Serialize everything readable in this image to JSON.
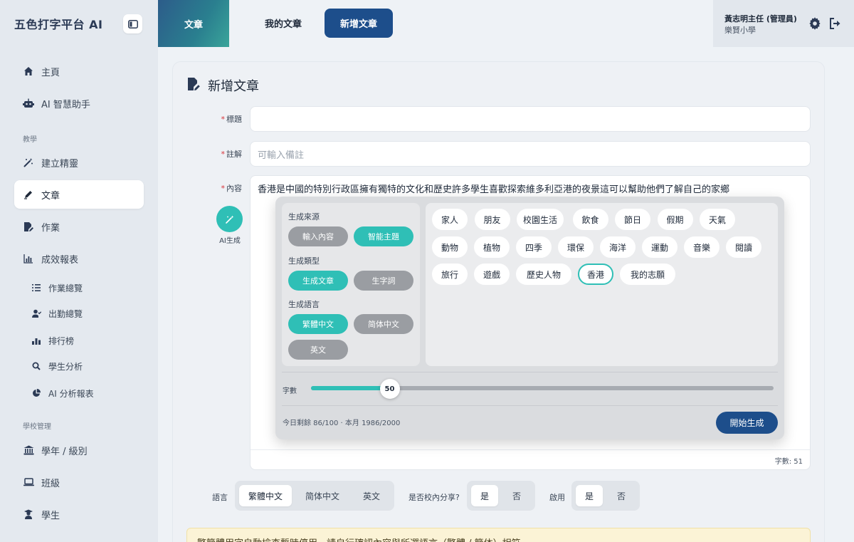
{
  "app": {
    "title": "五色打字平台 AI"
  },
  "sidebar": {
    "top_items": [
      {
        "label": "主頁",
        "icon": "home-icon"
      },
      {
        "label": "AI 智慧助手",
        "icon": "robot-icon"
      }
    ],
    "section_teaching": "教學",
    "teaching_items": [
      {
        "label": "建立精靈",
        "icon": "magic-wand-icon"
      },
      {
        "label": "文章",
        "icon": "pen-icon",
        "active": true
      },
      {
        "label": "作業",
        "icon": "file-edit-icon"
      },
      {
        "label": "成效報表",
        "icon": "bar-chart-icon"
      }
    ],
    "report_sub": [
      {
        "label": "作業總覽",
        "icon": "list-icon"
      },
      {
        "label": "出勤總覽",
        "icon": "user-check-icon"
      },
      {
        "label": "排行榜",
        "icon": "ranking-icon"
      },
      {
        "label": "學生分析",
        "icon": "search-icon"
      },
      {
        "label": "AI 分析報表",
        "icon": "pie-chart-icon"
      }
    ],
    "section_school": "學校管理",
    "school_items": [
      {
        "label": "學年 / 級別",
        "icon": "building-icon"
      },
      {
        "label": "班級",
        "icon": "laptop-icon"
      },
      {
        "label": "學生",
        "icon": "student-icon"
      }
    ]
  },
  "topbar": {
    "tab_article": "文章",
    "tab_my": "我的文章",
    "tab_new": "新增文章",
    "user_name": "黃志明主任 (管理員)",
    "user_school": "樂賢小學"
  },
  "form": {
    "title": "新增文章",
    "label_title": "標題",
    "title_value": "",
    "label_note": "註解",
    "note_placeholder": "可輸入備註",
    "label_content": "內容",
    "content_value": "香港是中國的特別行政區擁有獨特的文化和歷史許多學生喜歡探索維多利亞港的夜景這可以幫助他們了解自己的家鄉",
    "char_count": "字數: 51",
    "ai_label": "AI生成"
  },
  "ai_panel": {
    "source_title": "生成來源",
    "source_options": [
      {
        "label": "輸入內容",
        "on": false
      },
      {
        "label": "智能主題",
        "on": true
      }
    ],
    "type_title": "生成類型",
    "type_options": [
      {
        "label": "生成文章",
        "on": true
      },
      {
        "label": "生字詞",
        "on": false
      }
    ],
    "lang_title": "生成語言",
    "lang_options": [
      {
        "label": "繁體中文",
        "on": true
      },
      {
        "label": "简体中文",
        "on": false
      },
      {
        "label": "英文",
        "on": false
      }
    ],
    "topics": [
      "家人",
      "朋友",
      "校園生活",
      "飲食",
      "節日",
      "假期",
      "天氣",
      "動物",
      "植物",
      "四季",
      "環保",
      "海洋",
      "運動",
      "音樂",
      "閱讀",
      "旅行",
      "遊戲",
      "歷史人物",
      "香港",
      "我的志願"
    ],
    "selected_topic": "香港",
    "slider_label": "字數",
    "slider_value": "50",
    "slider_fraction": 0.17,
    "quota": "今日剩餘 86/100 · 本月 1986/2000",
    "generate_label": "開始生成"
  },
  "settings": {
    "lang_label": "語言",
    "lang_options": [
      "繁體中文",
      "简体中文",
      "英文"
    ],
    "share_label": "是否校內分享?",
    "share_options": [
      "是",
      "否"
    ],
    "enable_label": "啟用",
    "enable_options": [
      "是",
      "否"
    ]
  },
  "notice": "繁簡體用字自動檢查暫時停用，請自行確認內容與所選語言（繁體 / 簡体）相符。",
  "colors": {
    "accent": "#2fbfb6",
    "primary": "#1d4e8b"
  }
}
